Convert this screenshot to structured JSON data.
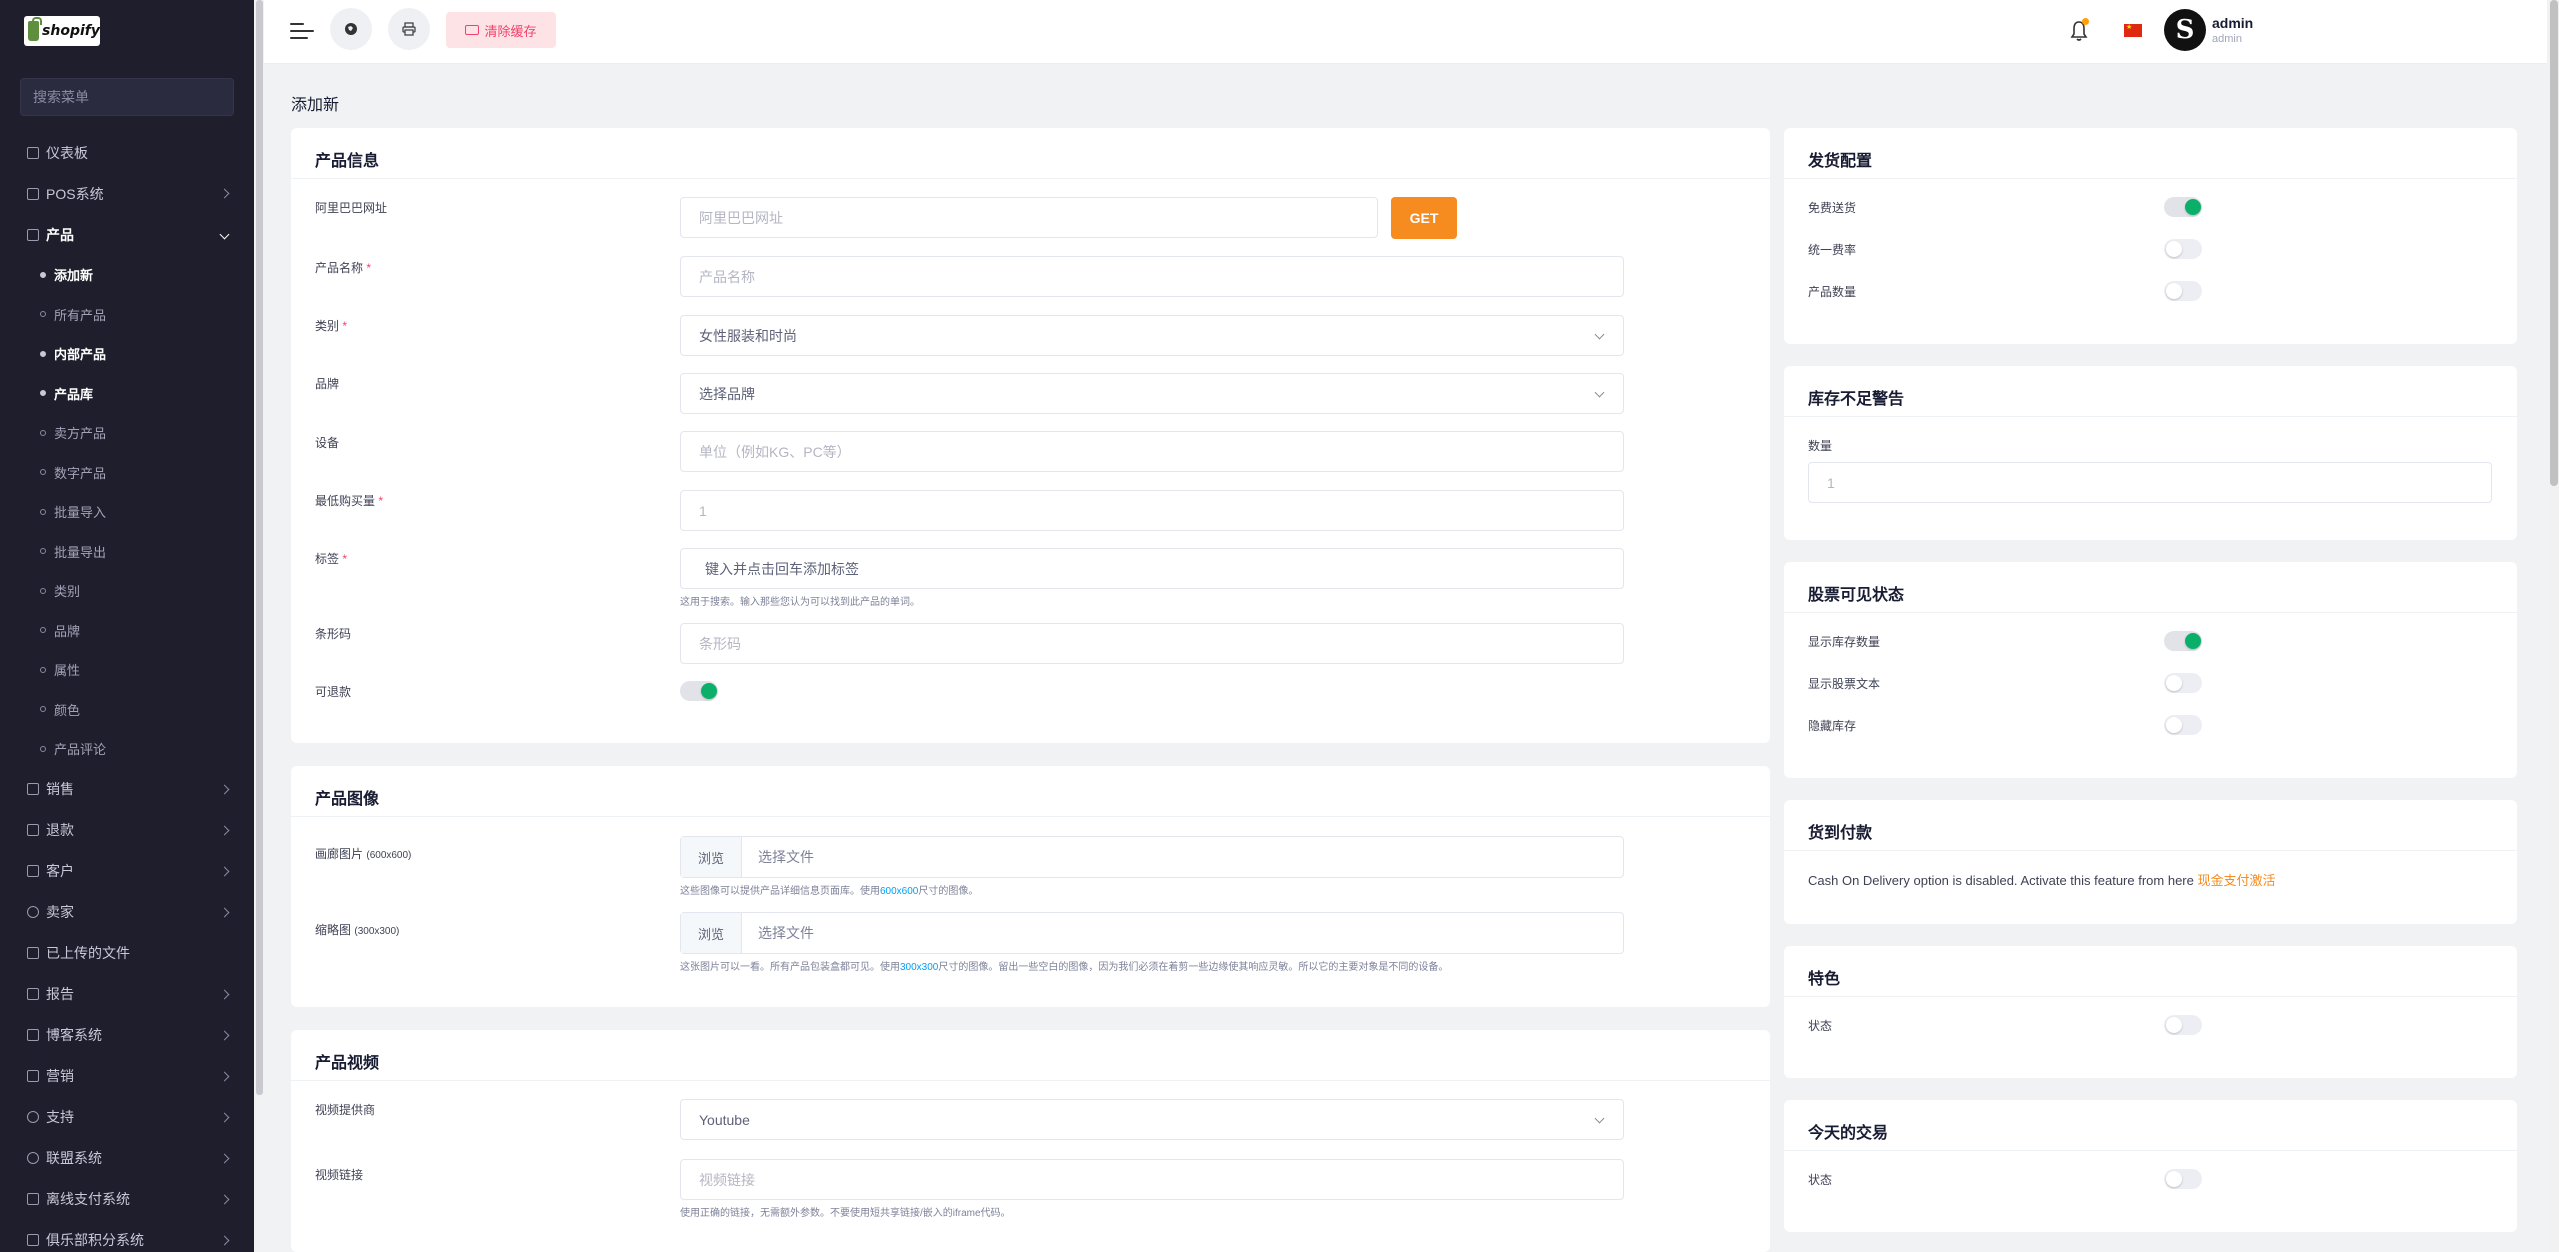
{
  "logo": {
    "text": "shopify"
  },
  "sidebar": {
    "search_placeholder": "搜索菜单",
    "items": [
      {
        "label": "仪表板"
      },
      {
        "label": "POS系统"
      },
      {
        "label": "产品"
      },
      {
        "label": "销售"
      },
      {
        "label": "退款"
      },
      {
        "label": "客户"
      },
      {
        "label": "卖家"
      },
      {
        "label": "已上传的文件"
      },
      {
        "label": "报告"
      },
      {
        "label": "博客系统"
      },
      {
        "label": "营销"
      },
      {
        "label": "支持"
      },
      {
        "label": "联盟系统"
      },
      {
        "label": "离线支付系统"
      },
      {
        "label": "俱乐部积分系统"
      }
    ],
    "sub_items": [
      {
        "label": "添加新"
      },
      {
        "label": "所有产品"
      },
      {
        "label": "内部产品"
      },
      {
        "label": "产品库"
      },
      {
        "label": "卖方产品"
      },
      {
        "label": "数字产品"
      },
      {
        "label": "批量导入"
      },
      {
        "label": "批量导出"
      },
      {
        "label": "类别"
      },
      {
        "label": "品牌"
      },
      {
        "label": "属性"
      },
      {
        "label": "颜色"
      },
      {
        "label": "产品评论"
      }
    ]
  },
  "topbar": {
    "clear_cache": "清除缓存",
    "user_name": "admin",
    "user_role": "admin"
  },
  "page": {
    "title": "添加新"
  },
  "product_info": {
    "title": "产品信息",
    "alibaba_label": "阿里巴巴网址",
    "alibaba_placeholder": "阿里巴巴网址",
    "get_button": "GET",
    "name_label": "产品名称",
    "name_placeholder": "产品名称",
    "category_label": "类别",
    "category_value": "女性服装和时尚",
    "brand_label": "品牌",
    "brand_value": "选择品牌",
    "unit_label": "设备",
    "unit_placeholder": "单位（例如KG、PC等）",
    "min_qty_label": "最低购买量",
    "min_qty_value": "1",
    "tags_label": "标签",
    "tags_placeholder": "键入并点击回车添加标签",
    "tags_help": "这用于搜索。输入那些您认为可以找到此产品的单词。",
    "barcode_label": "条形码",
    "barcode_placeholder": "条形码",
    "refundable_label": "可退款",
    "refundable": true
  },
  "product_images": {
    "title": "产品图像",
    "gallery_label": "画廊图片",
    "gallery_size": "(600x600)",
    "browse": "浏览",
    "choose_file": "选择文件",
    "gallery_help_pre": "这些图像可以提供产品详细信息页面库。使用",
    "gallery_help_hl": "600x600",
    "gallery_help_post": "尺寸的图像。",
    "thumb_label": "缩略图",
    "thumb_size": "(300x300)",
    "thumb_help_pre": "这张图片可以一看。所有产品包装盒都可见。使用",
    "thumb_help_hl": "300x300",
    "thumb_help_post": "尺寸的图像。留出一些空白的图像，因为我们必须在着剪一些边缘使其响应灵敏。所以它的主要对象是不同的设备。"
  },
  "product_video": {
    "title": "产品视频",
    "provider_label": "视频提供商",
    "provider_value": "Youtube",
    "link_label": "视频链接",
    "link_placeholder": "视频链接",
    "link_help": "使用正确的链接，无需额外参数。不要使用短共享链接/嵌入的iframe代码。"
  },
  "shipping": {
    "title": "发货配置",
    "free_label": "免费送货",
    "free": true,
    "flat_label": "统一费率",
    "flat": false,
    "qty_label": "产品数量",
    "qty": false
  },
  "low_stock": {
    "title": "库存不足警告",
    "qty_label": "数量",
    "qty_value": "1"
  },
  "stock_visibility": {
    "title": "股票可见状态",
    "show_qty_label": "显示库存数量",
    "show_qty": true,
    "show_text_label": "显示股票文本",
    "show_text": false,
    "hide_label": "隐藏库存",
    "hide": false
  },
  "cod": {
    "title": "货到付款",
    "text": "Cash On Delivery option is disabled. Activate this feature from here",
    "link": "现金支付激活"
  },
  "featured": {
    "title": "特色",
    "status_label": "状态",
    "status": false
  },
  "todays_deal": {
    "title": "今天的交易",
    "status_label": "状态",
    "status": false
  },
  "colors": {
    "accent": "#f68b1f",
    "toggle_on": "#0ab06a",
    "sidebar_bg": "#1e1e2d",
    "danger": "#f1416c"
  }
}
